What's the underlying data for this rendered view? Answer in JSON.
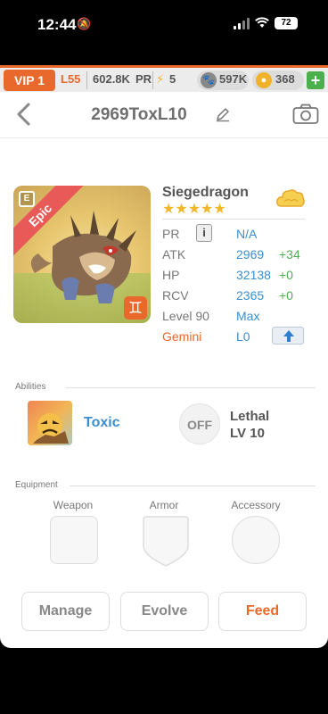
{
  "status_bar": {
    "time": "12:44",
    "battery": "72"
  },
  "game_bar": {
    "vip": "VIP 1",
    "level": "L55",
    "power": "602.8K",
    "power_unit": "PR",
    "energy": "5",
    "paw_currency": "597K",
    "gold_currency": "368",
    "add_label": "+"
  },
  "header": {
    "title": "2969ToxL10"
  },
  "monster": {
    "name": "Siegedragon",
    "rarity": "Epic",
    "stars": "★★★★★",
    "badge_letter": "E",
    "zodiac_symbol": "♊"
  },
  "stats": {
    "pr": {
      "label": "PR",
      "value": "N/A",
      "info": "i"
    },
    "atk": {
      "label": "ATK",
      "value": "2969",
      "bonus": "+34"
    },
    "hp": {
      "label": "HP",
      "value": "32138",
      "bonus": "+0"
    },
    "rcv": {
      "label": "RCV",
      "value": "2365",
      "bonus": "+0"
    },
    "level": {
      "label": "Level 90",
      "value": "Max"
    },
    "zodiac": {
      "label": "Gemini",
      "value": "L0"
    }
  },
  "abilities": {
    "section_label": "Abilities",
    "primary": {
      "name": "Toxic"
    },
    "secondary": {
      "state": "OFF",
      "name": "Lethal",
      "level": "LV 10"
    }
  },
  "equipment": {
    "section_label": "Equipment",
    "slots": [
      "Weapon",
      "Armor",
      "Accessory"
    ]
  },
  "actions": {
    "manage": "Manage",
    "evolve": "Evolve",
    "feed": "Feed"
  },
  "colors": {
    "accent": "#e9692c",
    "link_blue": "#3a8fd0",
    "bonus_green": "#4caf50",
    "epic_red": "#e85a57",
    "star_gold": "#f2b62a"
  }
}
